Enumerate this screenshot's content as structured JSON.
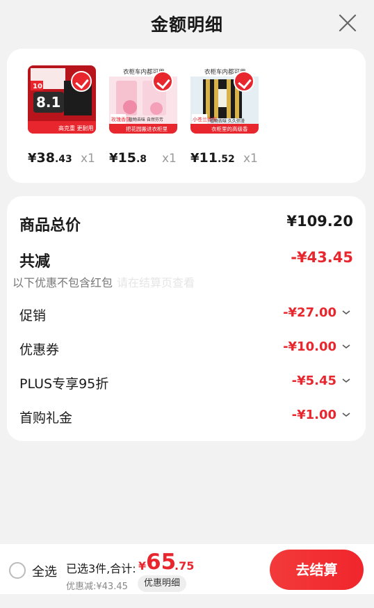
{
  "header": {
    "title": "金额明细"
  },
  "products": [
    {
      "name": "tissue-pack",
      "price_int": "38",
      "price_dec": ".43",
      "qty": "x1",
      "thumb_text": "8.1",
      "thumb_badge": "10",
      "thumb_caption": "高克重 更耐用"
    },
    {
      "name": "rose-fragrance",
      "price_int": "15",
      "price_dec": ".8",
      "qty": "x1",
      "thumb_top": "衣柜车内都可用",
      "thumb_side": "玫瑰香氛",
      "thumb_caption1": "植物去味 自然芬芳",
      "thumb_caption2": "把花园搬进衣柜里"
    },
    {
      "name": "lily-fragrance",
      "price_int": "11",
      "price_dec": ".52",
      "qty": "x1",
      "thumb_top": "衣柜车内都可用",
      "thumb_side": "小苍兰香型",
      "thumb_caption1": "植物去味 久久弥漫",
      "thumb_caption2": "衣柜里的高级香"
    }
  ],
  "currency": "¥",
  "summary": {
    "total_label": "商品总价",
    "total_value": "¥109.20",
    "reduction_label": "共减",
    "reduction_value": "-¥43.45",
    "note": "以下优惠不包含红包",
    "note_ghost": "请在结算页查看",
    "items": [
      {
        "label": "促销",
        "value": "-¥27.00"
      },
      {
        "label": "优惠券",
        "value": "-¥10.00"
      },
      {
        "label": "PLUS专享95折",
        "value": "-¥5.45"
      },
      {
        "label": "首购礼金",
        "value": "-¥1.00"
      }
    ]
  },
  "bottom": {
    "select_all": "全选",
    "selected_text": "已选3件,合计:",
    "total_cur": "¥",
    "total_int": "65",
    "total_dec": ".75",
    "discount_text": "优惠减:¥43.45",
    "detail_chip": "优惠明细",
    "checkout": "去结算"
  },
  "colors": {
    "accent": "#e8262e",
    "background": "#f2f2f2",
    "card": "#ffffff"
  },
  "icons": {
    "close": "close-icon",
    "check": "check-icon",
    "chevron": "chevron-down-icon"
  }
}
